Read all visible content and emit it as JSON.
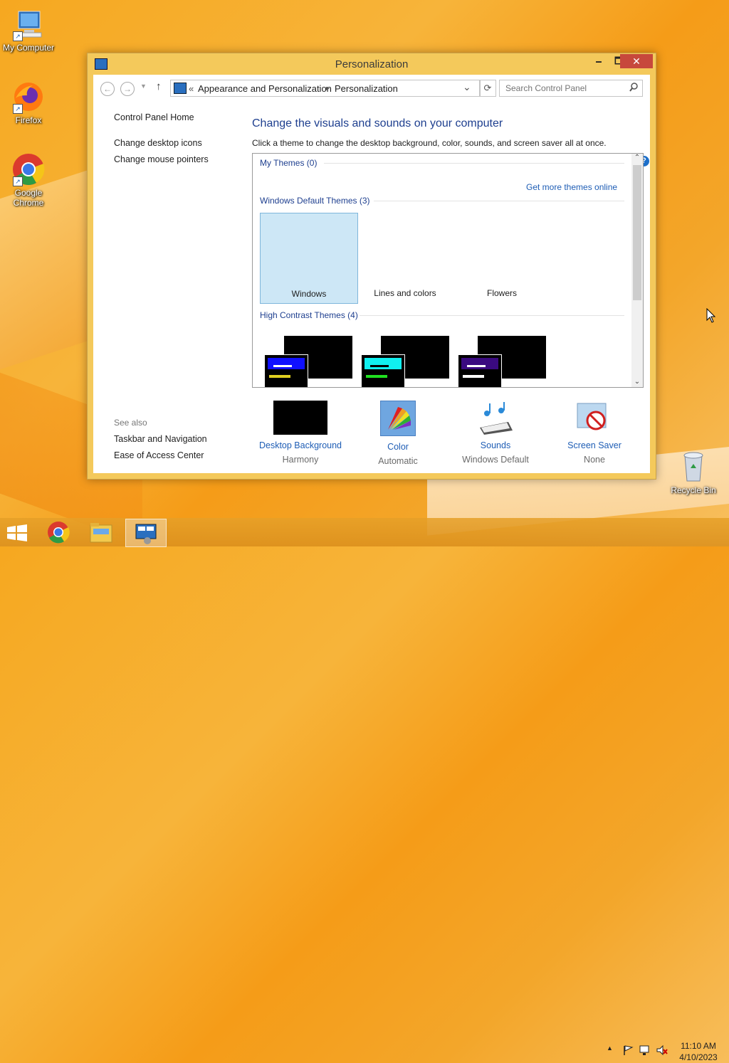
{
  "desktop": {
    "icons": [
      {
        "label": "My Computer"
      },
      {
        "label": "Firefox"
      },
      {
        "label": "Google Chrome"
      },
      {
        "label": "Recycle Bin"
      }
    ]
  },
  "window": {
    "title": "Personalization",
    "minimize": "🗕",
    "maximize": "🗖",
    "close": "✕"
  },
  "nav": {
    "back": "←",
    "forward": "→",
    "up": "↑",
    "breadcrumb_sep": "«",
    "crumbs": [
      "Appearance and Personalization",
      "Personalization"
    ],
    "crumb_arrow": "▸",
    "dropdown": "⌄",
    "refresh": "⟳",
    "search_placeholder": "Search Control Panel"
  },
  "sidebar": {
    "home": "Control Panel Home",
    "links": [
      "Change desktop icons",
      "Change mouse pointers"
    ],
    "see_also_label": "See also",
    "see_also": [
      "Taskbar and Navigation",
      "Ease of Access Center"
    ]
  },
  "main": {
    "heading": "Change the visuals and sounds on your computer",
    "subtext": "Click a theme to change the desktop background, color, sounds, and screen saver all at once.",
    "help": "?",
    "my_themes": "My Themes (0)",
    "get_more": "Get more themes online",
    "default_themes": "Windows Default Themes (3)",
    "themes": [
      "Windows",
      "Lines and colors",
      "Flowers"
    ],
    "high_contrast": "High Contrast Themes (4)",
    "hc_colors": [
      {
        "bar": "#1010ff",
        "line": "#e0d020"
      },
      {
        "bar": "#10f0f0",
        "line": "#20e020"
      },
      {
        "bar": "#3a0a80",
        "line": "#ffffff"
      }
    ]
  },
  "bottom": [
    {
      "name": "Desktop Background",
      "value": "Harmony"
    },
    {
      "name": "Color",
      "value": "Automatic"
    },
    {
      "name": "Sounds",
      "value": "Windows Default"
    },
    {
      "name": "Screen Saver",
      "value": "None"
    }
  ],
  "taskbar": {
    "time": "11:10 AM",
    "date": "4/10/2023",
    "tray_up": "▲"
  }
}
